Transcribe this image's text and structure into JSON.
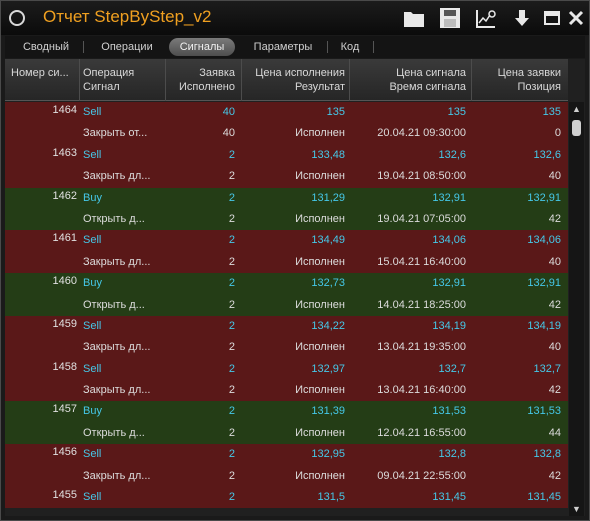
{
  "window": {
    "title": "Отчет StepByStep_v2"
  },
  "toolbar": {
    "icons": [
      "folder-icon",
      "save-icon",
      "chart-settings-icon",
      "download-icon",
      "maximize-icon",
      "close-icon"
    ]
  },
  "tabs": [
    {
      "label": "Сводный",
      "active": false
    },
    {
      "label": "Операции",
      "active": false
    },
    {
      "label": "Сигналы",
      "active": true
    },
    {
      "label": "Параметры",
      "active": false
    },
    {
      "label": "Код",
      "active": false
    }
  ],
  "columns": [
    {
      "line1": "Номер си...",
      "line2": ""
    },
    {
      "line1": "Операция",
      "line2": "Сигнал"
    },
    {
      "line1": "Заявка",
      "line2": "Исполнено"
    },
    {
      "line1": "Цена исполнения",
      "line2": "Результат"
    },
    {
      "line1": "Цена сигнала",
      "line2": "Время сигнала"
    },
    {
      "line1": "Цена заявки",
      "line2": "Позиция"
    }
  ],
  "rows": [
    {
      "side": "sell",
      "num": "1464",
      "op": "Sell",
      "qty": "40",
      "price": "135",
      "sig": "135",
      "pos": "135"
    },
    {
      "side": "sell",
      "num": "",
      "op": "Закрыть от...",
      "qty": "40",
      "price": "Исполнен",
      "sig": "20.04.21 09:30:00",
      "pos": "0"
    },
    {
      "side": "sell",
      "num": "1463",
      "op": "Sell",
      "qty": "2",
      "price": "133,48",
      "sig": "132,6",
      "pos": "132,6"
    },
    {
      "side": "sell",
      "num": "",
      "op": "Закрыть дл...",
      "qty": "2",
      "price": "Исполнен",
      "sig": "19.04.21 08:50:00",
      "pos": "40"
    },
    {
      "side": "buy",
      "num": "1462",
      "op": "Buy",
      "qty": "2",
      "price": "131,29",
      "sig": "132,91",
      "pos": "132,91"
    },
    {
      "side": "buy",
      "num": "",
      "op": "Открыть д...",
      "qty": "2",
      "price": "Исполнен",
      "sig": "19.04.21 07:05:00",
      "pos": "42"
    },
    {
      "side": "sell",
      "num": "1461",
      "op": "Sell",
      "qty": "2",
      "price": "134,49",
      "sig": "134,06",
      "pos": "134,06"
    },
    {
      "side": "sell",
      "num": "",
      "op": "Закрыть дл...",
      "qty": "2",
      "price": "Исполнен",
      "sig": "15.04.21 16:40:00",
      "pos": "40"
    },
    {
      "side": "buy",
      "num": "1460",
      "op": "Buy",
      "qty": "2",
      "price": "132,73",
      "sig": "132,91",
      "pos": "132,91"
    },
    {
      "side": "buy",
      "num": "",
      "op": "Открыть д...",
      "qty": "2",
      "price": "Исполнен",
      "sig": "14.04.21 18:25:00",
      "pos": "42"
    },
    {
      "side": "sell",
      "num": "1459",
      "op": "Sell",
      "qty": "2",
      "price": "134,22",
      "sig": "134,19",
      "pos": "134,19"
    },
    {
      "side": "sell",
      "num": "",
      "op": "Закрыть дл...",
      "qty": "2",
      "price": "Исполнен",
      "sig": "13.04.21 19:35:00",
      "pos": "40"
    },
    {
      "side": "sell",
      "num": "1458",
      "op": "Sell",
      "qty": "2",
      "price": "132,97",
      "sig": "132,7",
      "pos": "132,7"
    },
    {
      "side": "sell",
      "num": "",
      "op": "Закрыть дл...",
      "qty": "2",
      "price": "Исполнен",
      "sig": "13.04.21 16:40:00",
      "pos": "42"
    },
    {
      "side": "buy",
      "num": "1457",
      "op": "Buy",
      "qty": "2",
      "price": "131,39",
      "sig": "131,53",
      "pos": "131,53"
    },
    {
      "side": "buy",
      "num": "",
      "op": "Открыть д...",
      "qty": "2",
      "price": "Исполнен",
      "sig": "12.04.21 16:55:00",
      "pos": "44"
    },
    {
      "side": "sell",
      "num": "1456",
      "op": "Sell",
      "qty": "2",
      "price": "132,95",
      "sig": "132,8",
      "pos": "132,8"
    },
    {
      "side": "sell",
      "num": "",
      "op": "Закрыть дл...",
      "qty": "2",
      "price": "Исполнен",
      "sig": "09.04.21 22:55:00",
      "pos": "42"
    },
    {
      "side": "sell",
      "num": "1455",
      "op": "Sell",
      "qty": "2",
      "price": "131,5",
      "sig": "131,45",
      "pos": "131,45"
    }
  ],
  "colors": {
    "title": "#f0a020",
    "sell_row": "#5a1818",
    "buy_row": "#243d16",
    "value_cyan": "#45c8e8"
  }
}
